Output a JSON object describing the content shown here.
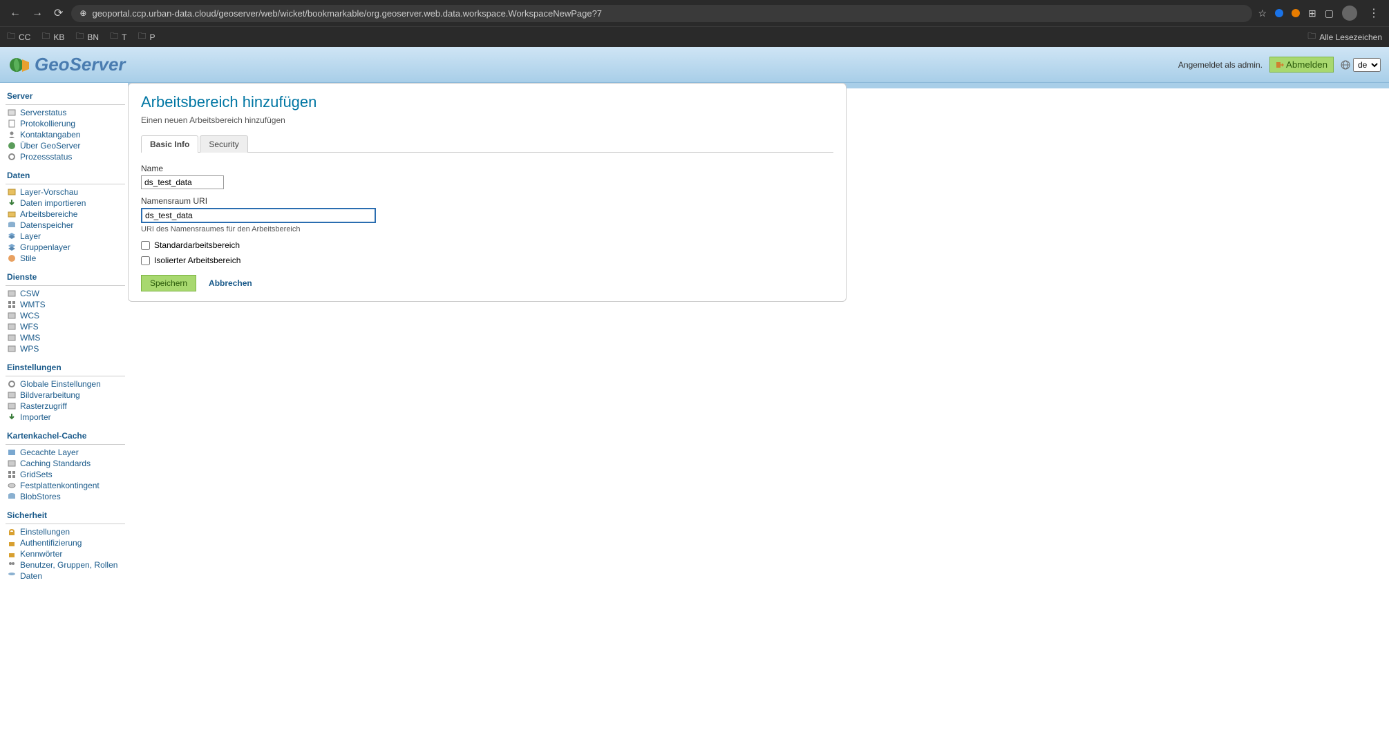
{
  "browser": {
    "url": "geoportal.ccp.urban-data.cloud/geoserver/web/wicket/bookmarkable/org.geoserver.web.data.workspace.WorkspaceNewPage?7",
    "bookmarks": [
      "CC",
      "KB",
      "BN",
      "T",
      "P"
    ],
    "all_bookmarks": "Alle Lesezeichen"
  },
  "header": {
    "logo_text": "GeoServer",
    "login_status": "Angemeldet als admin.",
    "logout": "Abmelden",
    "lang": "de"
  },
  "sidebar": {
    "sections": [
      {
        "title": "Server",
        "items": [
          "Serverstatus",
          "Protokollierung",
          "Kontaktangaben",
          "Über GeoServer",
          "Prozessstatus"
        ]
      },
      {
        "title": "Daten",
        "items": [
          "Layer-Vorschau",
          "Daten importieren",
          "Arbeitsbereiche",
          "Datenspeicher",
          "Layer",
          "Gruppenlayer",
          "Stile"
        ]
      },
      {
        "title": "Dienste",
        "items": [
          "CSW",
          "WMTS",
          "WCS",
          "WFS",
          "WMS",
          "WPS"
        ]
      },
      {
        "title": "Einstellungen",
        "items": [
          "Globale Einstellungen",
          "Bildverarbeitung",
          "Rasterzugriff",
          "Importer"
        ]
      },
      {
        "title": "Kartenkachel-Cache",
        "items": [
          "Gecachte Layer",
          "Caching Standards",
          "GridSets",
          "Festplattenkontingent",
          "BlobStores"
        ]
      },
      {
        "title": "Sicherheit",
        "items": [
          "Einstellungen",
          "Authentifizierung",
          "Kennwörter",
          "Benutzer, Gruppen, Rollen",
          "Daten"
        ]
      }
    ]
  },
  "main": {
    "title": "Arbeitsbereich hinzufügen",
    "subtitle": "Einen neuen Arbeitsbereich hinzufügen",
    "tabs": [
      "Basic Info",
      "Security"
    ],
    "active_tab": 0,
    "form": {
      "name_label": "Name",
      "name_value": "ds_test_data",
      "uri_label": "Namensraum URI",
      "uri_value": "ds_test_data",
      "uri_help": "URI des Namensraumes für den Arbeitsbereich",
      "default_ws_label": "Standardarbeitsbereich",
      "default_ws_checked": false,
      "isolated_label": "Isolierter Arbeitsbereich",
      "isolated_checked": false,
      "save": "Speichern",
      "cancel": "Abbrechen"
    }
  }
}
